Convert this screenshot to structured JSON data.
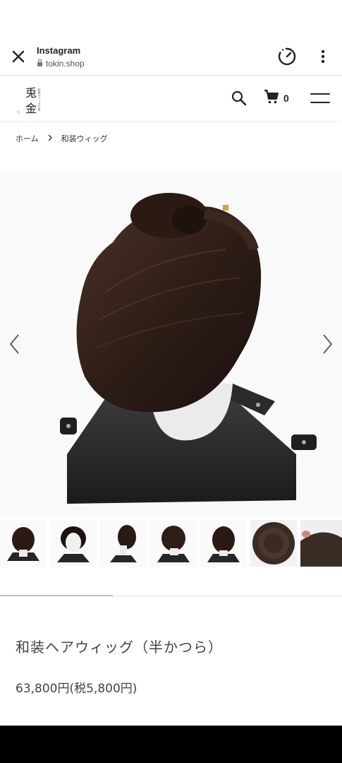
{
  "browser": {
    "title": "Instagram",
    "url": "tokin.shop"
  },
  "header": {
    "logo_text_main": "兎金",
    "logo_text_sub": "和装ウィッグ工房",
    "cart_count": "0"
  },
  "breadcrumb": {
    "home": "ホーム",
    "current": "和装ウィッグ"
  },
  "gallery": {
    "thumbnail_count": 7,
    "active_index": 0
  },
  "product": {
    "title": "和装ヘアウィッグ（半かつら）",
    "price": "63,800円(税5,800円)"
  },
  "colors": {
    "accent": "#222222",
    "hair": "#2a1a14",
    "stand": "#262626"
  }
}
